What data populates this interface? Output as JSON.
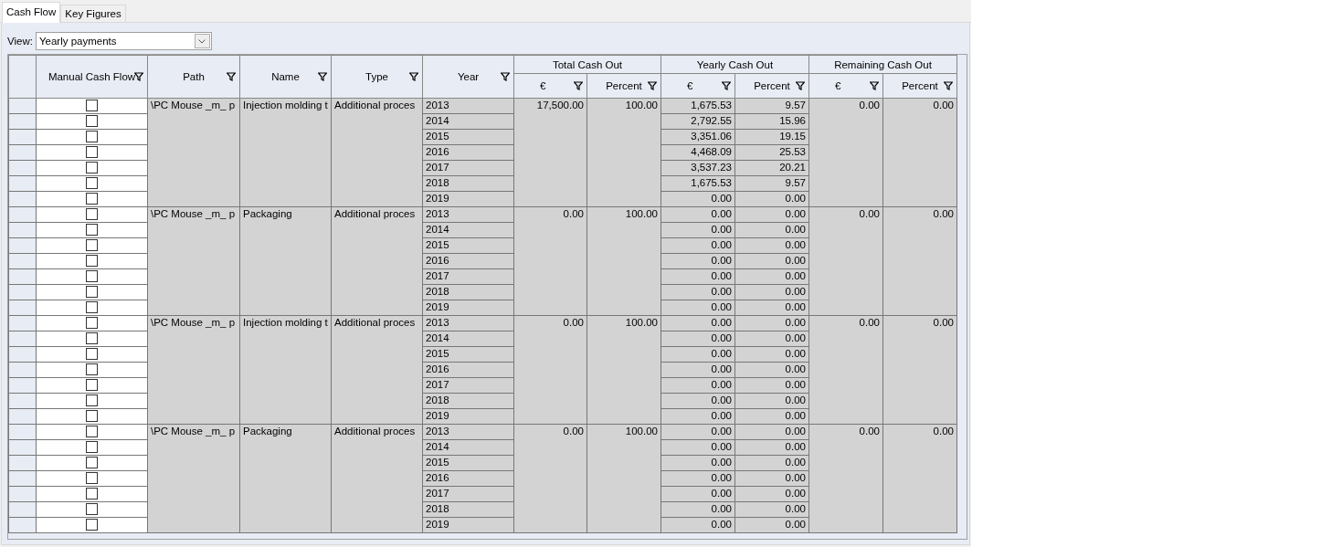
{
  "tabs": [
    {
      "label": "Cash Flow",
      "selected": true
    },
    {
      "label": "Key Figures",
      "selected": false
    }
  ],
  "view": {
    "label": "View:",
    "value": "Yearly payments"
  },
  "table": {
    "columns": [
      {
        "label": "Manual Cash Flow"
      },
      {
        "label": "Path"
      },
      {
        "label": "Name"
      },
      {
        "label": "Type"
      },
      {
        "label": "Year"
      }
    ],
    "column_groups": [
      {
        "label": "Total Cash Out",
        "columns": [
          "€",
          "Percent"
        ]
      },
      {
        "label": "Yearly Cash Out",
        "columns": [
          "€",
          "Percent"
        ]
      },
      {
        "label": "Remaining Cash Out",
        "columns": [
          "€",
          "Percent"
        ]
      }
    ],
    "groups": [
      {
        "path": "\\PC Mouse _m_ p",
        "name": "Injection molding t",
        "type": "Additional proces",
        "total_eur": "17,500.00",
        "total_pct": "100.00",
        "remaining_eur": "0.00",
        "remaining_pct": "0.00",
        "rows": [
          {
            "checked": false,
            "year": "2013",
            "eur": "1,675.53",
            "pct": "9.57"
          },
          {
            "checked": false,
            "year": "2014",
            "eur": "2,792.55",
            "pct": "15.96"
          },
          {
            "checked": false,
            "year": "2015",
            "eur": "3,351.06",
            "pct": "19.15"
          },
          {
            "checked": false,
            "year": "2016",
            "eur": "4,468.09",
            "pct": "25.53"
          },
          {
            "checked": false,
            "year": "2017",
            "eur": "3,537.23",
            "pct": "20.21"
          },
          {
            "checked": false,
            "year": "2018",
            "eur": "1,675.53",
            "pct": "9.57"
          },
          {
            "checked": false,
            "year": "2019",
            "eur": "0.00",
            "pct": "0.00"
          }
        ]
      },
      {
        "path": "\\PC Mouse _m_ p",
        "name": "Packaging",
        "type": "Additional proces",
        "total_eur": "0.00",
        "total_pct": "100.00",
        "remaining_eur": "0.00",
        "remaining_pct": "0.00",
        "rows": [
          {
            "checked": false,
            "year": "2013",
            "eur": "0.00",
            "pct": "0.00"
          },
          {
            "checked": false,
            "year": "2014",
            "eur": "0.00",
            "pct": "0.00"
          },
          {
            "checked": false,
            "year": "2015",
            "eur": "0.00",
            "pct": "0.00"
          },
          {
            "checked": false,
            "year": "2016",
            "eur": "0.00",
            "pct": "0.00"
          },
          {
            "checked": false,
            "year": "2017",
            "eur": "0.00",
            "pct": "0.00"
          },
          {
            "checked": false,
            "year": "2018",
            "eur": "0.00",
            "pct": "0.00"
          },
          {
            "checked": false,
            "year": "2019",
            "eur": "0.00",
            "pct": "0.00"
          }
        ]
      },
      {
        "path": "\\PC Mouse _m_ p",
        "name": "Injection molding t",
        "type": "Additional proces",
        "total_eur": "0.00",
        "total_pct": "100.00",
        "remaining_eur": "0.00",
        "remaining_pct": "0.00",
        "rows": [
          {
            "checked": false,
            "year": "2013",
            "eur": "0.00",
            "pct": "0.00"
          },
          {
            "checked": false,
            "year": "2014",
            "eur": "0.00",
            "pct": "0.00"
          },
          {
            "checked": false,
            "year": "2015",
            "eur": "0.00",
            "pct": "0.00"
          },
          {
            "checked": false,
            "year": "2016",
            "eur": "0.00",
            "pct": "0.00"
          },
          {
            "checked": false,
            "year": "2017",
            "eur": "0.00",
            "pct": "0.00"
          },
          {
            "checked": false,
            "year": "2018",
            "eur": "0.00",
            "pct": "0.00"
          },
          {
            "checked": false,
            "year": "2019",
            "eur": "0.00",
            "pct": "0.00"
          }
        ]
      },
      {
        "path": "\\PC Mouse _m_ p",
        "name": "Packaging",
        "type": "Additional proces",
        "total_eur": "0.00",
        "total_pct": "100.00",
        "remaining_eur": "0.00",
        "remaining_pct": "0.00",
        "rows": [
          {
            "checked": false,
            "year": "2013",
            "eur": "0.00",
            "pct": "0.00"
          },
          {
            "checked": false,
            "year": "2014",
            "eur": "0.00",
            "pct": "0.00"
          },
          {
            "checked": false,
            "year": "2015",
            "eur": "0.00",
            "pct": "0.00"
          },
          {
            "checked": false,
            "year": "2016",
            "eur": "0.00",
            "pct": "0.00"
          },
          {
            "checked": false,
            "year": "2017",
            "eur": "0.00",
            "pct": "0.00"
          },
          {
            "checked": false,
            "year": "2018",
            "eur": "0.00",
            "pct": "0.00"
          },
          {
            "checked": false,
            "year": "2019",
            "eur": "0.00",
            "pct": "0.00"
          }
        ]
      }
    ]
  }
}
